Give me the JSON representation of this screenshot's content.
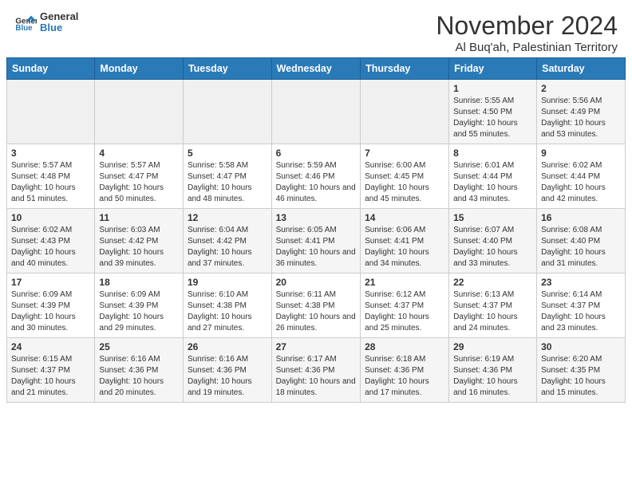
{
  "header": {
    "logo_line1": "General",
    "logo_line2": "Blue",
    "title": "November 2024",
    "subtitle": "Al Buq'ah, Palestinian Territory"
  },
  "weekdays": [
    "Sunday",
    "Monday",
    "Tuesday",
    "Wednesday",
    "Thursday",
    "Friday",
    "Saturday"
  ],
  "weeks": [
    [
      {
        "day": "",
        "info": ""
      },
      {
        "day": "",
        "info": ""
      },
      {
        "day": "",
        "info": ""
      },
      {
        "day": "",
        "info": ""
      },
      {
        "day": "",
        "info": ""
      },
      {
        "day": "1",
        "info": "Sunrise: 5:55 AM\nSunset: 4:50 PM\nDaylight: 10 hours and 55 minutes."
      },
      {
        "day": "2",
        "info": "Sunrise: 5:56 AM\nSunset: 4:49 PM\nDaylight: 10 hours and 53 minutes."
      }
    ],
    [
      {
        "day": "3",
        "info": "Sunrise: 5:57 AM\nSunset: 4:48 PM\nDaylight: 10 hours and 51 minutes."
      },
      {
        "day": "4",
        "info": "Sunrise: 5:57 AM\nSunset: 4:47 PM\nDaylight: 10 hours and 50 minutes."
      },
      {
        "day": "5",
        "info": "Sunrise: 5:58 AM\nSunset: 4:47 PM\nDaylight: 10 hours and 48 minutes."
      },
      {
        "day": "6",
        "info": "Sunrise: 5:59 AM\nSunset: 4:46 PM\nDaylight: 10 hours and 46 minutes."
      },
      {
        "day": "7",
        "info": "Sunrise: 6:00 AM\nSunset: 4:45 PM\nDaylight: 10 hours and 45 minutes."
      },
      {
        "day": "8",
        "info": "Sunrise: 6:01 AM\nSunset: 4:44 PM\nDaylight: 10 hours and 43 minutes."
      },
      {
        "day": "9",
        "info": "Sunrise: 6:02 AM\nSunset: 4:44 PM\nDaylight: 10 hours and 42 minutes."
      }
    ],
    [
      {
        "day": "10",
        "info": "Sunrise: 6:02 AM\nSunset: 4:43 PM\nDaylight: 10 hours and 40 minutes."
      },
      {
        "day": "11",
        "info": "Sunrise: 6:03 AM\nSunset: 4:42 PM\nDaylight: 10 hours and 39 minutes."
      },
      {
        "day": "12",
        "info": "Sunrise: 6:04 AM\nSunset: 4:42 PM\nDaylight: 10 hours and 37 minutes."
      },
      {
        "day": "13",
        "info": "Sunrise: 6:05 AM\nSunset: 4:41 PM\nDaylight: 10 hours and 36 minutes."
      },
      {
        "day": "14",
        "info": "Sunrise: 6:06 AM\nSunset: 4:41 PM\nDaylight: 10 hours and 34 minutes."
      },
      {
        "day": "15",
        "info": "Sunrise: 6:07 AM\nSunset: 4:40 PM\nDaylight: 10 hours and 33 minutes."
      },
      {
        "day": "16",
        "info": "Sunrise: 6:08 AM\nSunset: 4:40 PM\nDaylight: 10 hours and 31 minutes."
      }
    ],
    [
      {
        "day": "17",
        "info": "Sunrise: 6:09 AM\nSunset: 4:39 PM\nDaylight: 10 hours and 30 minutes."
      },
      {
        "day": "18",
        "info": "Sunrise: 6:09 AM\nSunset: 4:39 PM\nDaylight: 10 hours and 29 minutes."
      },
      {
        "day": "19",
        "info": "Sunrise: 6:10 AM\nSunset: 4:38 PM\nDaylight: 10 hours and 27 minutes."
      },
      {
        "day": "20",
        "info": "Sunrise: 6:11 AM\nSunset: 4:38 PM\nDaylight: 10 hours and 26 minutes."
      },
      {
        "day": "21",
        "info": "Sunrise: 6:12 AM\nSunset: 4:37 PM\nDaylight: 10 hours and 25 minutes."
      },
      {
        "day": "22",
        "info": "Sunrise: 6:13 AM\nSunset: 4:37 PM\nDaylight: 10 hours and 24 minutes."
      },
      {
        "day": "23",
        "info": "Sunrise: 6:14 AM\nSunset: 4:37 PM\nDaylight: 10 hours and 23 minutes."
      }
    ],
    [
      {
        "day": "24",
        "info": "Sunrise: 6:15 AM\nSunset: 4:37 PM\nDaylight: 10 hours and 21 minutes."
      },
      {
        "day": "25",
        "info": "Sunrise: 6:16 AM\nSunset: 4:36 PM\nDaylight: 10 hours and 20 minutes."
      },
      {
        "day": "26",
        "info": "Sunrise: 6:16 AM\nSunset: 4:36 PM\nDaylight: 10 hours and 19 minutes."
      },
      {
        "day": "27",
        "info": "Sunrise: 6:17 AM\nSunset: 4:36 PM\nDaylight: 10 hours and 18 minutes."
      },
      {
        "day": "28",
        "info": "Sunrise: 6:18 AM\nSunset: 4:36 PM\nDaylight: 10 hours and 17 minutes."
      },
      {
        "day": "29",
        "info": "Sunrise: 6:19 AM\nSunset: 4:36 PM\nDaylight: 10 hours and 16 minutes."
      },
      {
        "day": "30",
        "info": "Sunrise: 6:20 AM\nSunset: 4:35 PM\nDaylight: 10 hours and 15 minutes."
      }
    ]
  ]
}
